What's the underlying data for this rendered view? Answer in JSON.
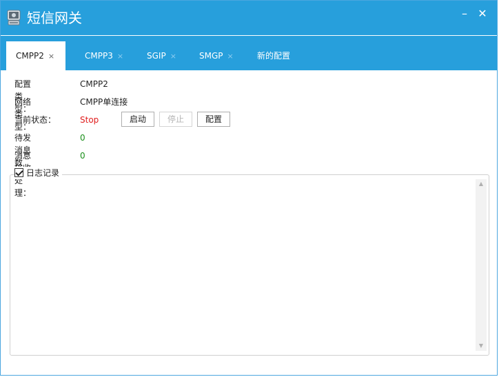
{
  "window": {
    "title": "短信网关"
  },
  "tabs": [
    {
      "label": "CMPP2",
      "active": true
    },
    {
      "label": "CMPP3",
      "active": false
    },
    {
      "label": "SGIP",
      "active": false
    },
    {
      "label": "SMGP",
      "active": false
    },
    {
      "label": "新的配置",
      "active": false
    }
  ],
  "tab_close_glyph": "×",
  "fields": {
    "config_type": {
      "label": "配置类型：",
      "value": "CMPP2"
    },
    "network_type": {
      "label": "网络类型：",
      "value": "CMPP单连接"
    },
    "status": {
      "label": "当前状态：",
      "value": "Stop"
    },
    "pending": {
      "label": "待发消息数量：",
      "value": "0"
    },
    "received": {
      "label": "消息接收处理：",
      "value": "0"
    }
  },
  "buttons": {
    "start": "启动",
    "stop": "停止",
    "config": "配置"
  },
  "log": {
    "label": "日志记录",
    "checked": true
  },
  "colors": {
    "titlebar": "#279fdc",
    "status_stop": "#e01b1b",
    "count": "#1a8f1a"
  },
  "icons": [
    "app-icon",
    "minimize-icon",
    "close-icon",
    "tab-close-icon",
    "checkbox-icon"
  ]
}
